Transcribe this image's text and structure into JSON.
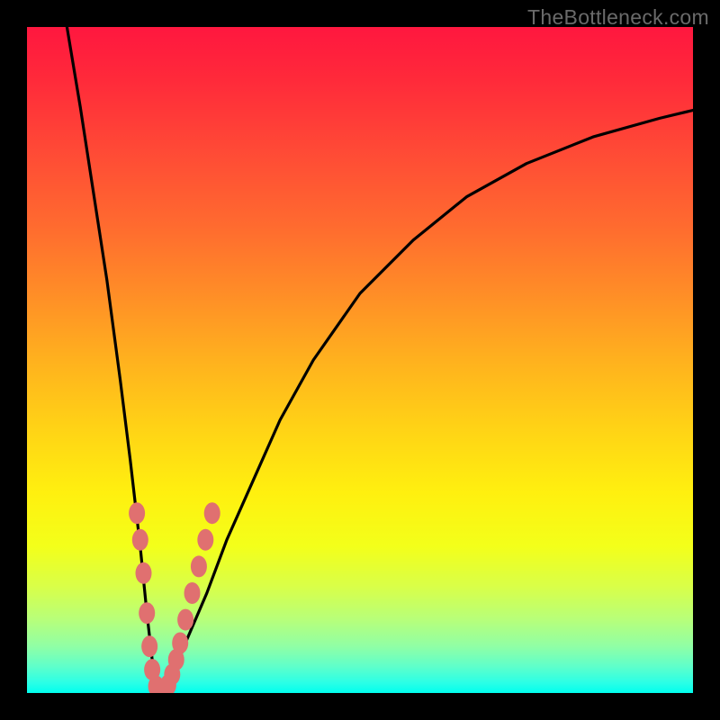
{
  "watermark": "TheBottleneck.com",
  "colors": {
    "frame": "#000000",
    "curve": "#000000",
    "dot": "#e07070",
    "gradient_top": "#ff173f",
    "gradient_bottom": "#00ffee"
  },
  "chart_data": {
    "type": "line",
    "title": "",
    "xlabel": "",
    "ylabel": "",
    "xlim": [
      0,
      100
    ],
    "ylim": [
      0,
      100
    ],
    "series": [
      {
        "name": "bottleneck-curve",
        "x": [
          6,
          8,
          10,
          12,
          14,
          15.5,
          17,
          18,
          18.8,
          19.4,
          20,
          20.8,
          22,
          24,
          27,
          30,
          34,
          38,
          43,
          50,
          58,
          66,
          75,
          85,
          95,
          100
        ],
        "y": [
          100,
          88,
          75,
          62,
          47,
          35,
          22,
          12,
          5,
          1,
          0,
          0.6,
          3,
          8,
          15,
          23,
          32,
          41,
          50,
          60,
          68,
          74.5,
          79.5,
          83.5,
          86.3,
          87.5
        ]
      }
    ],
    "markers": {
      "name": "highlight-dots",
      "points": [
        {
          "x": 16.5,
          "y": 27
        },
        {
          "x": 17.0,
          "y": 23
        },
        {
          "x": 17.5,
          "y": 18
        },
        {
          "x": 18.0,
          "y": 12
        },
        {
          "x": 18.4,
          "y": 7
        },
        {
          "x": 18.8,
          "y": 3.5
        },
        {
          "x": 19.4,
          "y": 1
        },
        {
          "x": 20.0,
          "y": 0
        },
        {
          "x": 20.6,
          "y": 0.3
        },
        {
          "x": 21.2,
          "y": 1.2
        },
        {
          "x": 21.8,
          "y": 2.8
        },
        {
          "x": 22.4,
          "y": 5
        },
        {
          "x": 23.0,
          "y": 7.5
        },
        {
          "x": 23.8,
          "y": 11
        },
        {
          "x": 24.8,
          "y": 15
        },
        {
          "x": 25.8,
          "y": 19
        },
        {
          "x": 26.8,
          "y": 23
        },
        {
          "x": 27.8,
          "y": 27
        }
      ]
    }
  }
}
